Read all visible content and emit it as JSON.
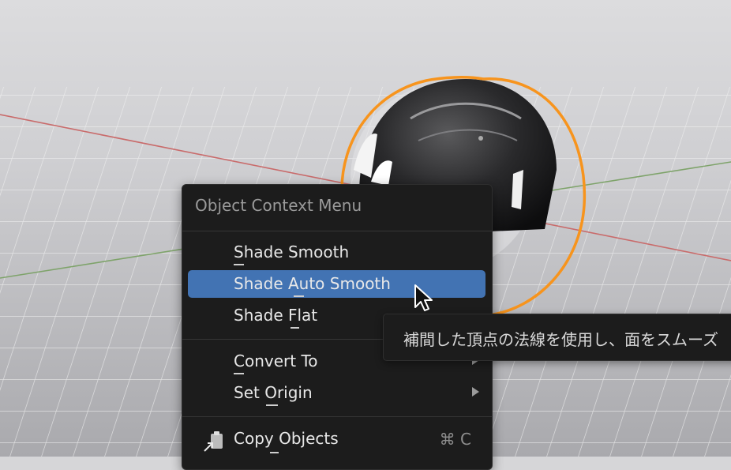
{
  "context_menu": {
    "title": "Object Context Menu",
    "items": [
      {
        "label": "Shade Smooth",
        "mnemonic": "S"
      },
      {
        "label": "Shade Auto Smooth",
        "mnemonic": "A",
        "active": true
      },
      {
        "label": "Shade Flat",
        "mnemonic": "F"
      },
      {
        "label": "Convert To",
        "mnemonic": "C",
        "submenu": true
      },
      {
        "label": "Set Origin",
        "mnemonic": "O",
        "submenu": true
      },
      {
        "label": "Copy Objects",
        "mnemonic": "y",
        "shortcut": "⌘ C",
        "icon": "copy-icon"
      }
    ]
  },
  "tooltip": {
    "text": "補間した頂点の法線を使用し、面をスムーズ"
  },
  "colors": {
    "menu_bg": "#1c1c1c",
    "highlight": "#4273b3",
    "selection_outline": "#f7941d",
    "axis_x": "#c96b6b",
    "axis_y": "#7ea36a"
  }
}
